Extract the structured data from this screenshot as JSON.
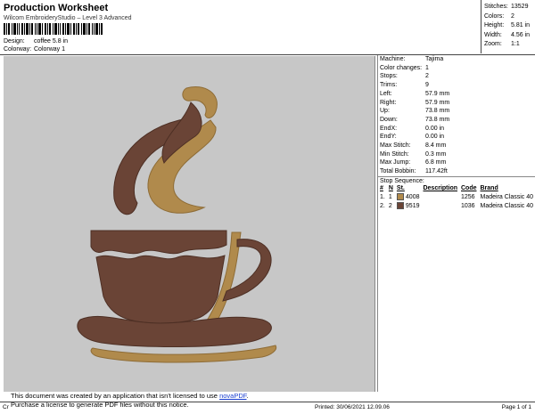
{
  "header": {
    "title": "Production Worksheet",
    "subtitle": "Wilcom EmbroideryStudio – Level 3 Advanced",
    "design_label": "Design:",
    "design_value": "coffee 5.8 in",
    "colorway_label": "Colorway:",
    "colorway_value": "Colorway 1"
  },
  "top_stats": [
    {
      "label": "Stitches:",
      "value": "13529"
    },
    {
      "label": "Colors:",
      "value": "2"
    },
    {
      "label": "Height:",
      "value": "5.81 in"
    },
    {
      "label": "Width:",
      "value": "4.56 in"
    },
    {
      "label": "Zoom:",
      "value": "1:1"
    }
  ],
  "specs": [
    {
      "label": "Machine:",
      "value": "Tajima"
    },
    {
      "label": "Color changes:",
      "value": "1"
    },
    {
      "label": "Stops:",
      "value": "2"
    },
    {
      "label": "Trims:",
      "value": "9"
    },
    {
      "label": "Left:",
      "value": "57.9 mm"
    },
    {
      "label": "Right:",
      "value": "57.9 mm"
    },
    {
      "label": "Up:",
      "value": "73.8 mm"
    },
    {
      "label": "Down:",
      "value": "73.8 mm"
    },
    {
      "label": "EndX:",
      "value": "0.00 in"
    },
    {
      "label": "EndY:",
      "value": "0.00 in"
    },
    {
      "label": "Max Stitch:",
      "value": "8.4 mm"
    },
    {
      "label": "Min Stitch:",
      "value": "0.3 mm"
    },
    {
      "label": "Max Jump:",
      "value": "6.8 mm"
    },
    {
      "label": "Total Bobbin:",
      "value": "117.42ft"
    }
  ],
  "stop_sequence": {
    "title": "Stop Sequence:",
    "columns": [
      "#",
      "N",
      "St.",
      "Description",
      "Code",
      "Brand"
    ],
    "rows": [
      {
        "num": "1.",
        "n": "1",
        "color": "#b08a4c",
        "st": "4008",
        "description": "",
        "code": "1256",
        "brand": "Madeira Classic 40"
      },
      {
        "num": "2.",
        "n": "2",
        "color": "#6a4436",
        "st": "9519",
        "description": "",
        "code": "1036",
        "brand": "Madeira Classic 40"
      }
    ]
  },
  "notice": {
    "line1_prefix": "This document was created by an application that isn't licensed to use ",
    "link": "novaPDF",
    "line1_suffix": ".",
    "line2": "Purchase a license to generate PDF files without this notice."
  },
  "footer": {
    "left": "Cr",
    "printed": "Printed: 30/06/2021 12.09.06",
    "page": "Page 1 of 1"
  },
  "colors": {
    "brown": "#6a4436",
    "gold": "#b08a4c",
    "canvas": "#c7c7c7"
  }
}
